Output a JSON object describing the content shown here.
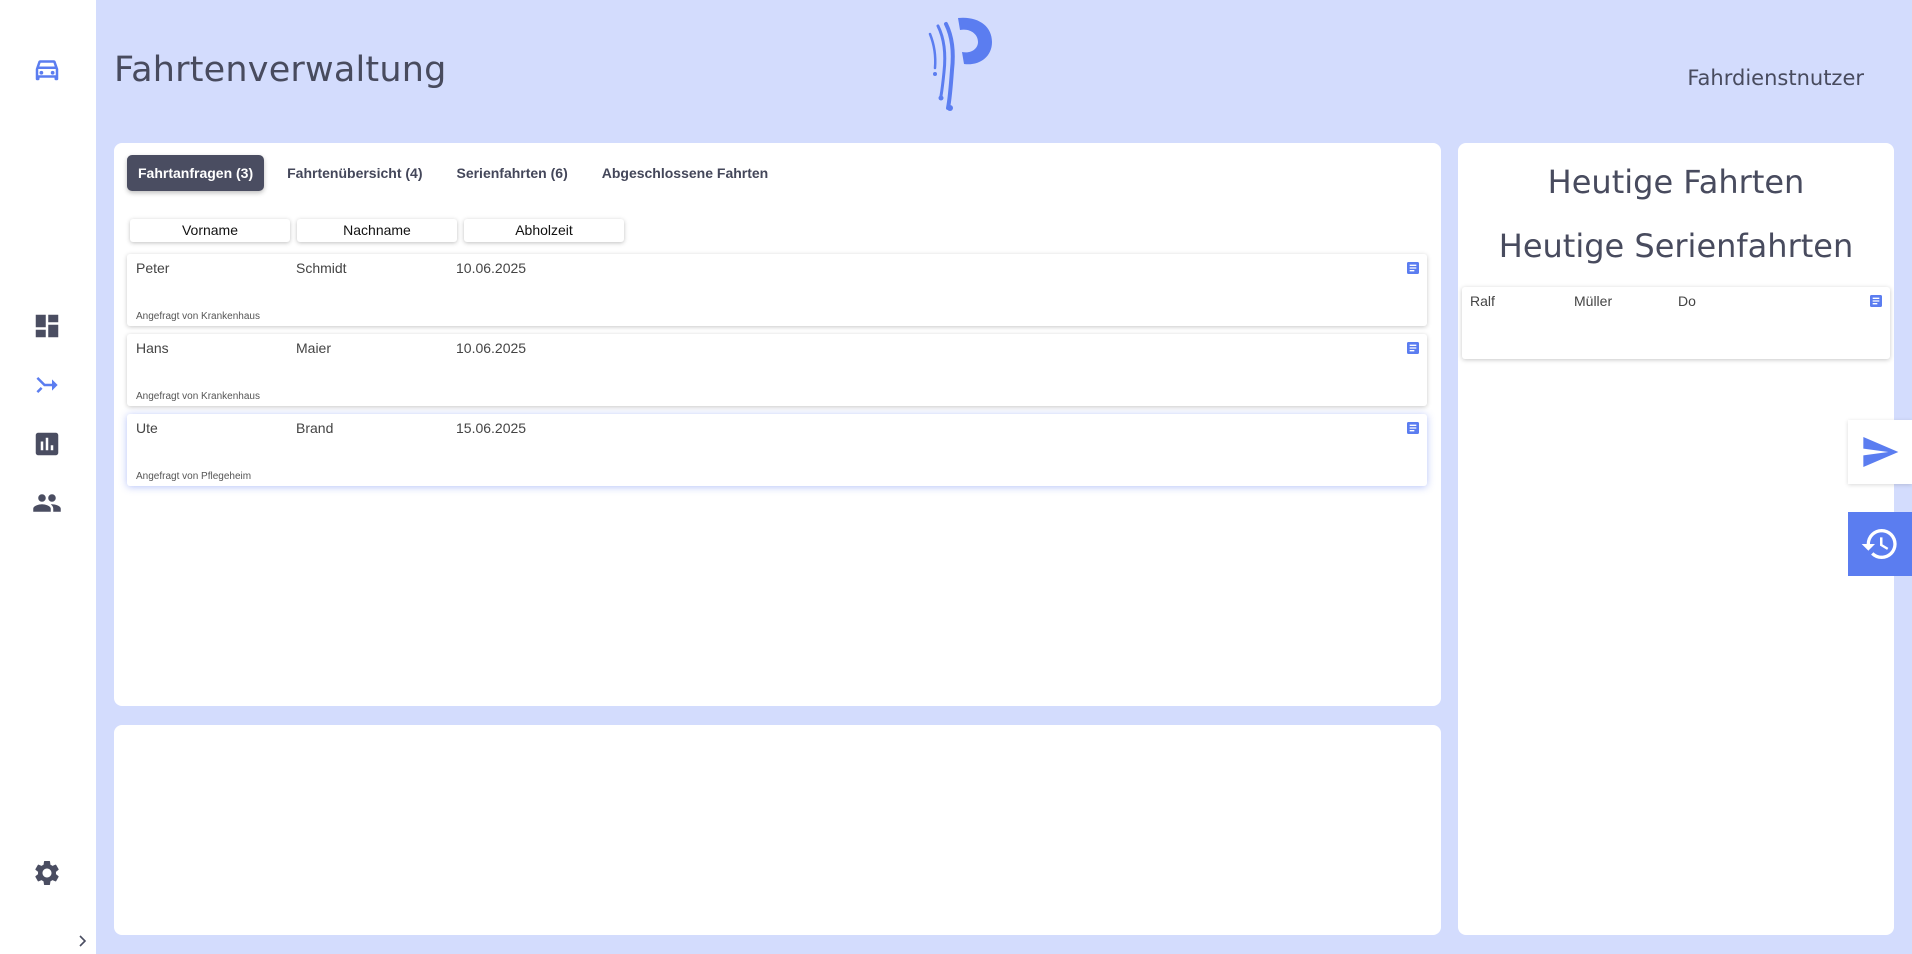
{
  "header": {
    "title": "Fahrtenverwaltung",
    "user": "Fahrdienstnutzer"
  },
  "colors": {
    "accent": "#5b7df0",
    "background": "#d3dcfd",
    "active_tab": "#4a4d61",
    "sidebar_icon": "#4a4d61"
  },
  "sidebar": {
    "items": [
      {
        "icon": "car-icon"
      },
      {
        "icon": "dashboard-icon"
      },
      {
        "icon": "route-merge-icon"
      },
      {
        "icon": "bar-chart-icon"
      },
      {
        "icon": "group-icon"
      },
      {
        "icon": "gear-icon"
      }
    ]
  },
  "tabs": [
    {
      "label": "Fahrtanfragen (3)",
      "active": true
    },
    {
      "label": "Fahrtenübersicht (4)",
      "active": false
    },
    {
      "label": "Serienfahrten (6)",
      "active": false
    },
    {
      "label": "Abgeschlossene Fahrten",
      "active": false
    }
  ],
  "columns": [
    "Vorname",
    "Nachname",
    "Abholzeit"
  ],
  "requests": [
    {
      "first": "Peter",
      "last": "Schmidt",
      "date": "10.06.2025",
      "requested": "Angefragt von Krankenhaus"
    },
    {
      "first": "Hans",
      "last": "Maier",
      "date": "10.06.2025",
      "requested": "Angefragt von Krankenhaus"
    },
    {
      "first": "Ute",
      "last": "Brand",
      "date": "15.06.2025",
      "requested": "Angefragt von Pflegeheim"
    }
  ],
  "right_panel": {
    "today_title": "Heutige Fahrten",
    "series_title": "Heutige Serienfahrten",
    "series": [
      {
        "first": "Ralf",
        "last": "Müller",
        "day": "Do"
      }
    ]
  }
}
